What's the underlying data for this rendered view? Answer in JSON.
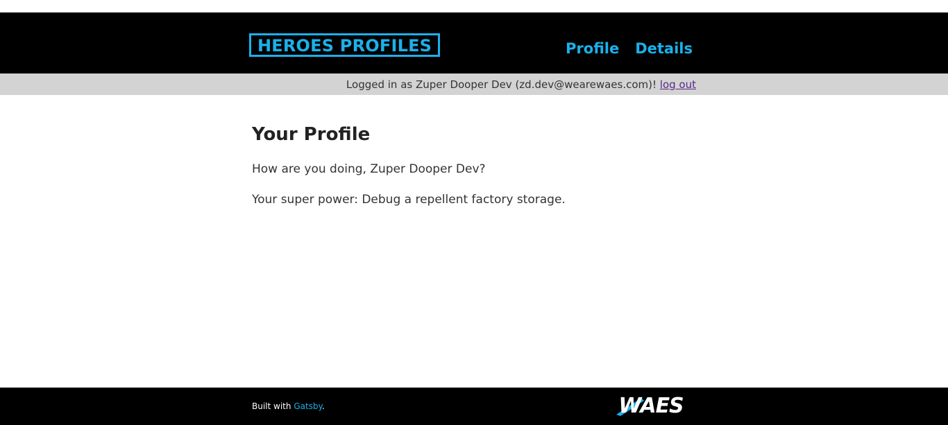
{
  "header": {
    "logo_text": "HEROES PROFILES",
    "nav": [
      {
        "label": "Profile"
      },
      {
        "label": "Details"
      }
    ]
  },
  "status_bar": {
    "logged_in_text": "Logged in as Zuper Dooper Dev (zd.dev@wearewaes.com)! ",
    "logout_label": "log out"
  },
  "main": {
    "title": "Your Profile",
    "greeting": "How are you doing, Zuper Dooper Dev?",
    "super_power": "Your super power: Debug a repellent factory storage."
  },
  "footer": {
    "built_with_prefix": "Built with ",
    "built_with_link": "Gatsby",
    "built_with_suffix": ".",
    "brand_logo_text": "WAES"
  },
  "colors": {
    "accent": "#1ab1ec",
    "header_bg": "#000000",
    "status_bg": "#d3d3d3",
    "link_visited": "#5a2a8a"
  }
}
